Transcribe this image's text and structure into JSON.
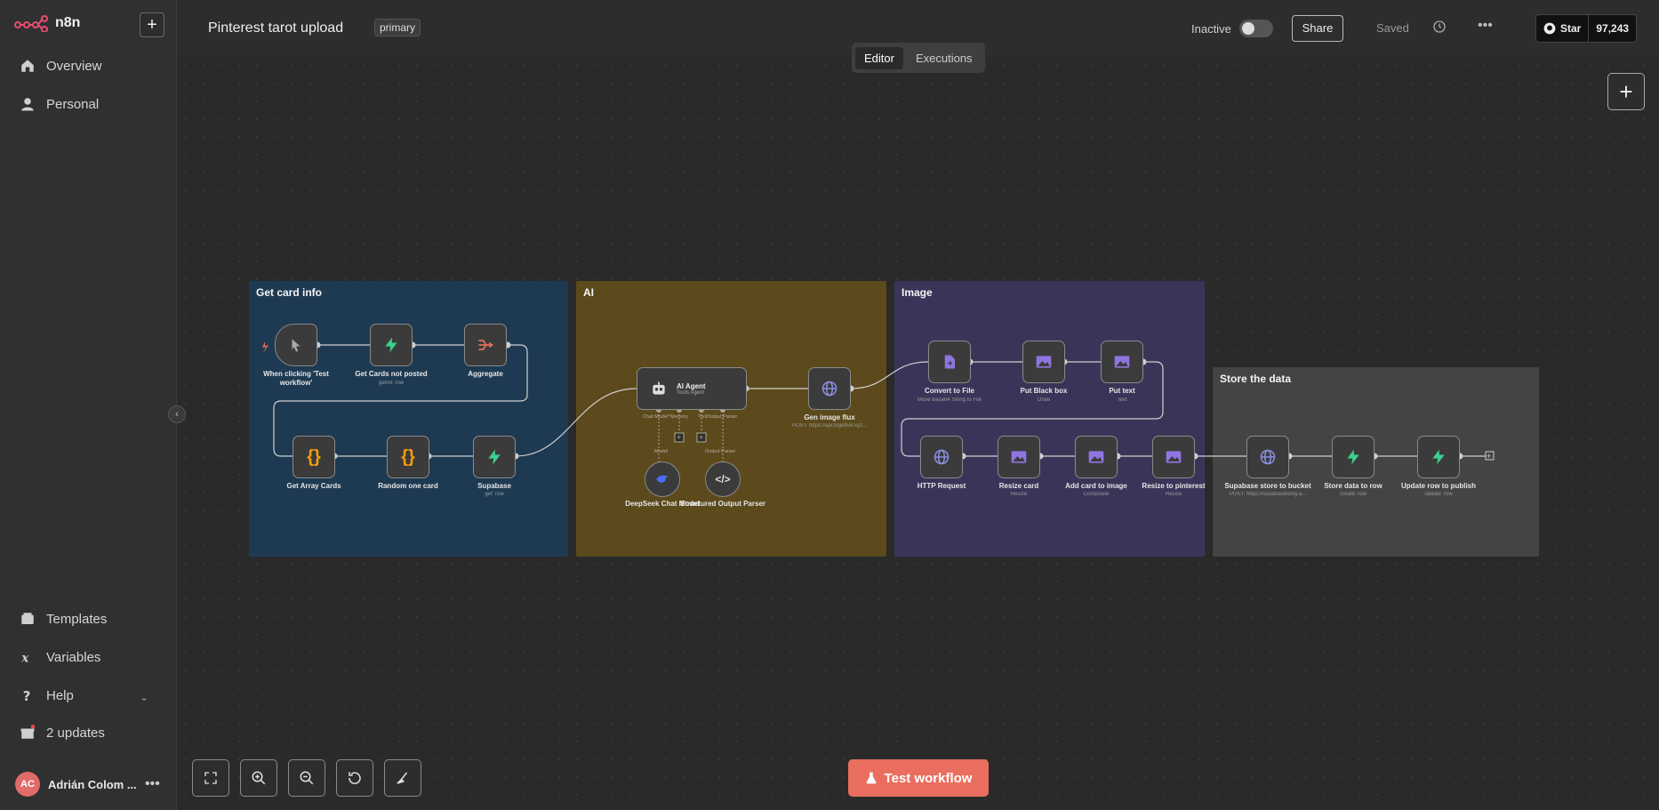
{
  "app": {
    "logo_text": "n8n"
  },
  "sidebar": {
    "items": [
      {
        "label": "Overview",
        "icon": "home-icon"
      },
      {
        "label": "Personal",
        "icon": "user-icon"
      }
    ],
    "bottom_items": [
      {
        "label": "Templates",
        "icon": "templates-icon"
      },
      {
        "label": "Variables",
        "icon": "variables-icon"
      },
      {
        "label": "Help",
        "icon": "help-icon"
      },
      {
        "label": "2 updates",
        "icon": "gift-icon"
      }
    ],
    "user": {
      "initials": "AC",
      "name": "Adrián Colom ..."
    }
  },
  "header": {
    "workflow_name": "Pinterest tarot upload",
    "tag": "primary",
    "status": "Inactive",
    "share_label": "Share",
    "saved_label": "Saved",
    "github": {
      "star_label": "Star",
      "count": "97,243"
    }
  },
  "tabs": [
    {
      "label": "Editor",
      "active": true
    },
    {
      "label": "Executions",
      "active": false
    }
  ],
  "stickies": [
    {
      "title": "Get card info",
      "color": "#1e3a52"
    },
    {
      "title": "AI",
      "color": "#5c4a1c"
    },
    {
      "title": "Image",
      "color": "#3a3558"
    },
    {
      "title": "Store the data",
      "color": "#444444"
    }
  ],
  "nodes": [
    {
      "label": "When clicking 'Test workflow'",
      "sub": "",
      "icon": "cursor-icon"
    },
    {
      "label": "Get Cards not posted",
      "sub": "getAll: row",
      "icon": "supabase-icon"
    },
    {
      "label": "Aggregate",
      "sub": "",
      "icon": "aggregate-icon"
    },
    {
      "label": "Get Array Cards",
      "sub": "",
      "icon": "code-icon"
    },
    {
      "label": "Random one card",
      "sub": "",
      "icon": "code-icon"
    },
    {
      "label": "Supabase",
      "sub": "get: row",
      "icon": "supabase-icon"
    },
    {
      "label": "AI Agent",
      "sub": "Tools Agent",
      "icon": "robot-icon"
    },
    {
      "label": "Gen image flux",
      "sub": "POST: https://api.together.xyz...",
      "icon": "globe-icon"
    },
    {
      "label": "DeepSeek Chat Model",
      "sub": "",
      "icon": "deepseek-icon"
    },
    {
      "label": "Structured Output Parser",
      "sub": "",
      "icon": "code-tag-icon"
    },
    {
      "label": "Convert to File",
      "sub": "Move Base64 String to File",
      "icon": "file-icon"
    },
    {
      "label": "Put Black box",
      "sub": "Draw",
      "icon": "image-icon"
    },
    {
      "label": "Put text",
      "sub": "Text",
      "icon": "image-icon"
    },
    {
      "label": "HTTP Request",
      "sub": "",
      "icon": "globe-icon"
    },
    {
      "label": "Resize card",
      "sub": "Resize",
      "icon": "image-icon"
    },
    {
      "label": "Add card to image",
      "sub": "Composite",
      "icon": "image-icon"
    },
    {
      "label": "Resize to pinterest",
      "sub": "Resize",
      "icon": "image-icon"
    },
    {
      "label": "Supabase store to bucket",
      "sub": "POST: https://supabasekong.a...",
      "icon": "globe-icon"
    },
    {
      "label": "Store data to row",
      "sub": "create: row",
      "icon": "supabase-icon"
    },
    {
      "label": "Update row to publish",
      "sub": "update: row",
      "icon": "supabase-icon"
    }
  ],
  "ports": {
    "chat_model": "Chat Model*",
    "memory": "Memory",
    "tool": "Tool",
    "output_parser": "Output Parser",
    "model": "Model",
    "output_parser2": "Output Parser"
  },
  "bottom": {
    "test_label": "Test workflow"
  },
  "colors": {
    "accent": "#ea6e5f",
    "supabase": "#3ecf8e",
    "code": "#f59e0b",
    "image": "#8f75e0",
    "globe": "#8b8fe0"
  }
}
